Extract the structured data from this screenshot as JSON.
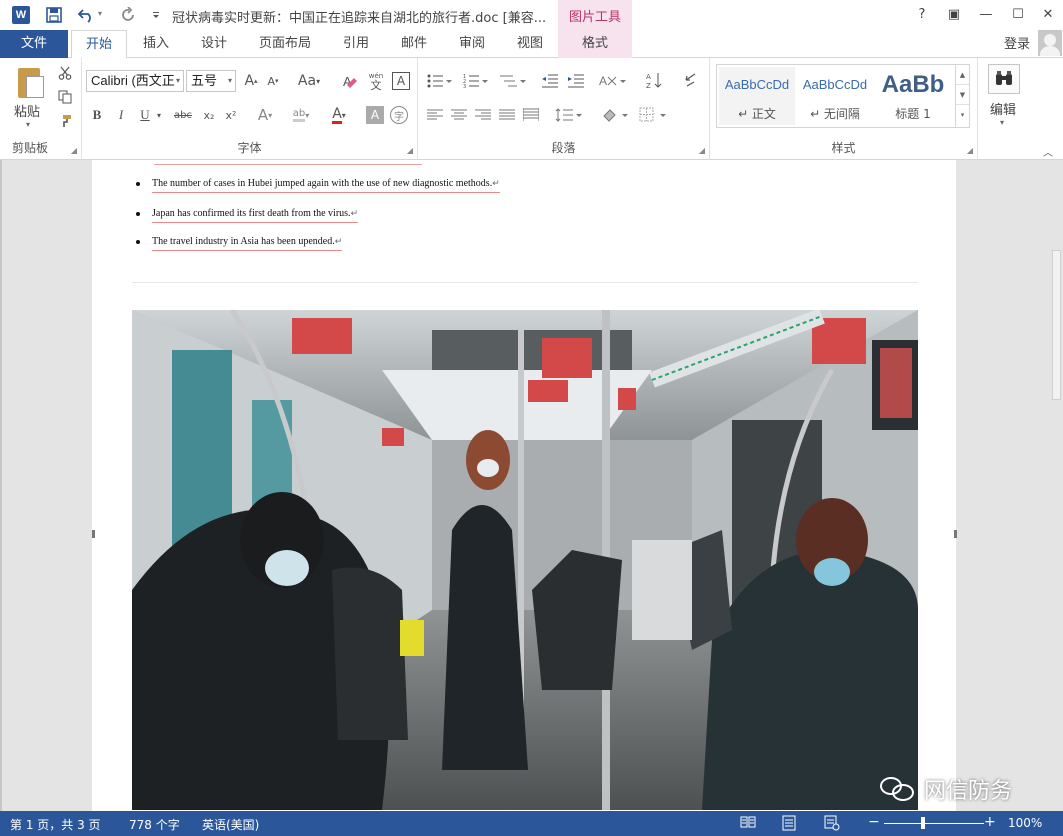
{
  "titlebar": {
    "doc_title": "冠状病毒实时更新：中国正在追踪来自湖北的旅行者.doc [兼容...",
    "contextual_tools": "图片工具",
    "app_icon": "W",
    "help": "?",
    "ribbon_display": "▣",
    "minimize": "—",
    "maximize": "☐",
    "close": "✕",
    "icons": {
      "save": "save-icon",
      "undo": "undo-icon",
      "redo": "redo-icon",
      "customize": "customize-qat-icon"
    }
  },
  "tabs": [
    {
      "label": "文件"
    },
    {
      "label": "开始"
    },
    {
      "label": "插入"
    },
    {
      "label": "设计"
    },
    {
      "label": "页面布局"
    },
    {
      "label": "引用"
    },
    {
      "label": "邮件"
    },
    {
      "label": "审阅"
    },
    {
      "label": "视图"
    },
    {
      "label": "格式"
    }
  ],
  "account": {
    "signin": "登录"
  },
  "ribbon": {
    "clipboard": {
      "label": "剪贴板",
      "paste": "粘贴"
    },
    "font": {
      "label": "字体",
      "font_name": "Calibri (西文正",
      "font_size": "五号",
      "grow": "A",
      "shrink": "A",
      "case": "Aa",
      "pinyin": "wén",
      "pinyin_sub": "文",
      "border_char": "A",
      "bold": "B",
      "italic": "I",
      "underline": "U",
      "strike": "abc",
      "subscript": "x₂",
      "superscript": "x²",
      "effects": "A",
      "highlight": "ab",
      "font_color": "A",
      "shading": "A",
      "enclose": "字"
    },
    "paragraph": {
      "label": "段落"
    },
    "styles": {
      "label": "样式",
      "items": [
        {
          "sample": "AaBbCcDd",
          "name": "↵ 正文"
        },
        {
          "sample": "AaBbCcDd",
          "name": "↵ 无间隔"
        },
        {
          "sample": "AaBb",
          "name": "标题 1"
        }
      ]
    },
    "editing": {
      "label": "编辑"
    }
  },
  "document": {
    "bullets": [
      "The number of cases in Hubei jumped again with the use of new diagnostic methods.",
      "Japan has confirmed its first death from the virus.",
      "The travel industry in Asia has been upended."
    ],
    "paragraph_mark": "↵"
  },
  "watermark": {
    "text": "网信防务"
  },
  "statusbar": {
    "page": "第 1 页，共 3 页",
    "words": "778 个字",
    "language": "英语(美国)",
    "zoom": "100%",
    "zoom_level": 1.0,
    "zoom_minus": "−",
    "zoom_plus": "+"
  },
  "colors": {
    "word_blue": "#2b579a",
    "picture_tools_pink": "#f7e3ee",
    "picture_tools_text": "#b9336a"
  }
}
